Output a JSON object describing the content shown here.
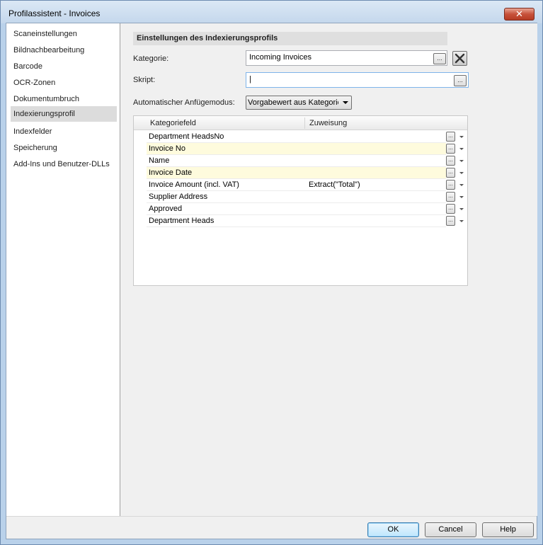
{
  "window": {
    "title": "Profilassistent - Invoices",
    "close_label": "✕"
  },
  "sidebar": {
    "items": [
      {
        "label": "Scaneinstellungen"
      },
      {
        "label": "Bildnachbearbeitung"
      },
      {
        "label": "Barcode"
      },
      {
        "label": "OCR-Zonen"
      },
      {
        "label": "Dokumentumbruch"
      },
      {
        "label": "Indexierungsprofil",
        "active": true
      },
      {
        "label": "Indexfelder"
      },
      {
        "label": "Speicherung"
      },
      {
        "label": "Add-Ins und Benutzer-DLLs"
      }
    ]
  },
  "main": {
    "section_title": "Einstellungen des Indexierungsprofils",
    "kategorie_label": "Kategorie:",
    "kategorie_value": "Incoming Invoices",
    "skript_label": "Skript:",
    "skript_value": "|",
    "anfuege_label": "Automatischer Anfügemodus:",
    "anfuege_value": "Vorgabewert aus Kategorie",
    "ellipsis": "...",
    "grid": {
      "col_field": "Kategoriefeld",
      "col_assign": "Zuweisung",
      "rows": [
        {
          "field": "Department HeadsNo",
          "assign": "",
          "highlight": false
        },
        {
          "field": "Invoice No",
          "assign": "",
          "highlight": true
        },
        {
          "field": "Name",
          "assign": "",
          "highlight": false
        },
        {
          "field": "Invoice Date",
          "assign": "",
          "highlight": true
        },
        {
          "field": "Invoice Amount (incl. VAT)",
          "assign": "Extract(\"Total\")",
          "highlight": false
        },
        {
          "field": "Supplier Address",
          "assign": "",
          "highlight": false
        },
        {
          "field": "Approved",
          "assign": "",
          "highlight": false
        },
        {
          "field": "Department Heads",
          "assign": "",
          "highlight": false
        }
      ]
    }
  },
  "footer": {
    "ok": "OK",
    "cancel": "Cancel",
    "help": "Help"
  }
}
